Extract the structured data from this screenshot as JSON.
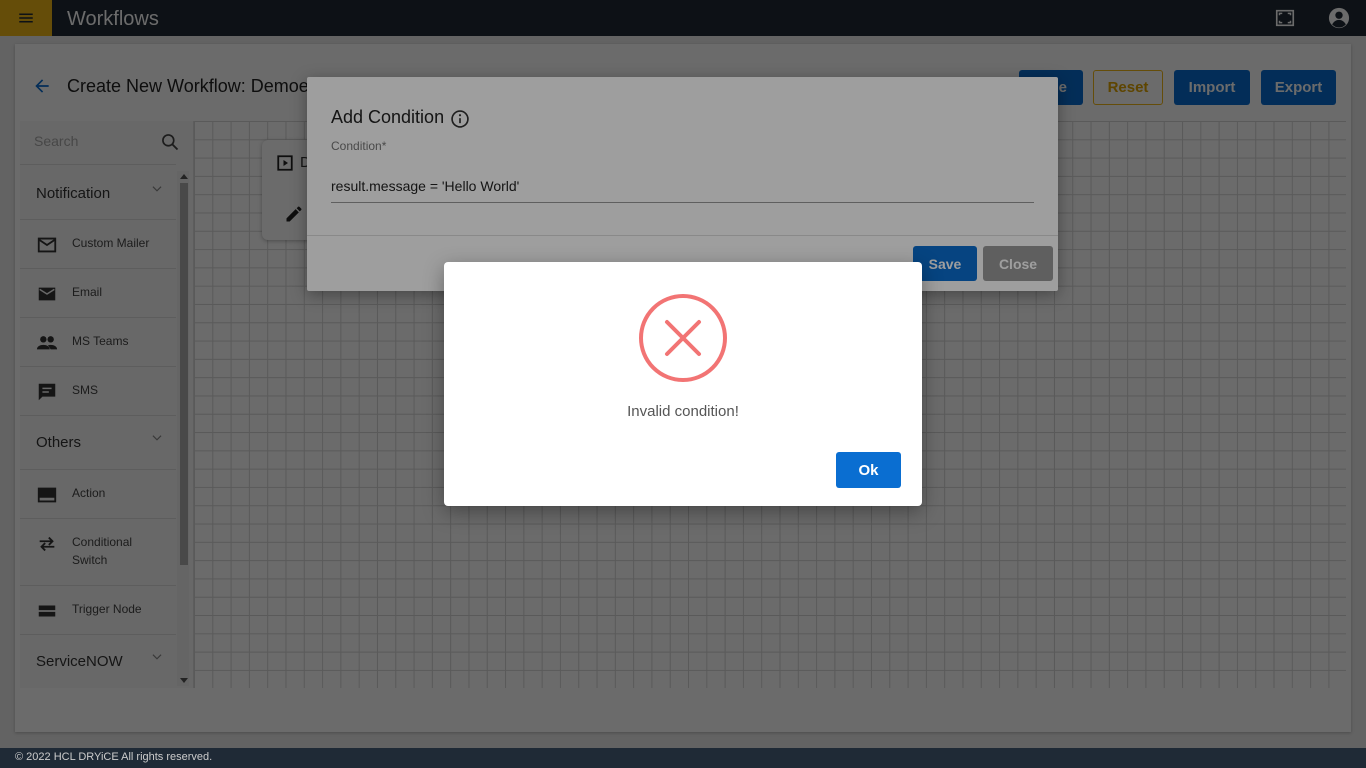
{
  "topbar": {
    "title": "Workflows",
    "icons": [
      "menu-icon",
      "fullscreen-icon",
      "account-icon"
    ]
  },
  "page": {
    "title": "Create New Workflow: Demoe",
    "buttons": {
      "save_partial": "e",
      "reset": "Reset",
      "import": "Import",
      "export": "Export"
    }
  },
  "sidebar": {
    "search_placeholder": "Search",
    "groups": [
      {
        "label": "Notification",
        "items": [
          {
            "label": "Custom Mailer",
            "icon": "mail-outline-icon"
          },
          {
            "label": "Email",
            "icon": "mail-icon"
          },
          {
            "label": "MS Teams",
            "icon": "people-icon"
          },
          {
            "label": "SMS",
            "icon": "message-icon"
          }
        ]
      },
      {
        "label": "Others",
        "items": [
          {
            "label": "Action",
            "icon": "action-icon"
          },
          {
            "label": "Conditional Switch",
            "icon": "swap-icon"
          },
          {
            "label": "Trigger Node",
            "icon": "trigger-icon"
          }
        ]
      },
      {
        "label": "ServiceNOW",
        "items": []
      }
    ]
  },
  "canvas": {
    "node_label": "D"
  },
  "condition_dialog": {
    "title": "Add Condition",
    "field_label": "Condition*",
    "field_value": "result.message = 'Hello World'",
    "save": "Save",
    "close": "Close"
  },
  "alert": {
    "message": "Invalid condition!",
    "ok": "Ok",
    "icon_color": "#f27474"
  },
  "footer": {
    "text": "© 2022 HCL DRYiCE All rights reserved."
  },
  "colors": {
    "topbar": "#1f2a36",
    "accent_yellow": "#f2b818",
    "primary_blue": "#0a6ed1"
  }
}
